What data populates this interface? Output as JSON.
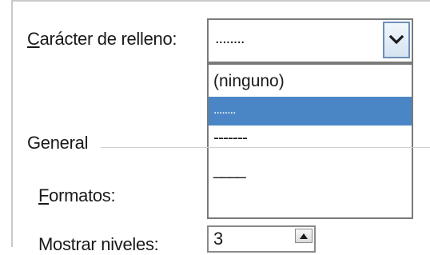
{
  "fill_char": {
    "label_accel": "C",
    "label_rest": "arácter de relleno:",
    "selected_value": "........",
    "options": [
      "(ninguno)",
      "........",
      "-------",
      "____"
    ],
    "selected_index": 1
  },
  "general": {
    "group_label": "General",
    "formats_accel": "F",
    "formats_rest": "ormatos:",
    "levels_label": "Mostrar niveles:",
    "levels_value": "3"
  },
  "colors": {
    "selection": "#4a86c5",
    "button_border": "#6d8fb8"
  },
  "icons": {
    "dropdown": "chevron-down-icon",
    "spin_up": "triangle-up-icon"
  }
}
